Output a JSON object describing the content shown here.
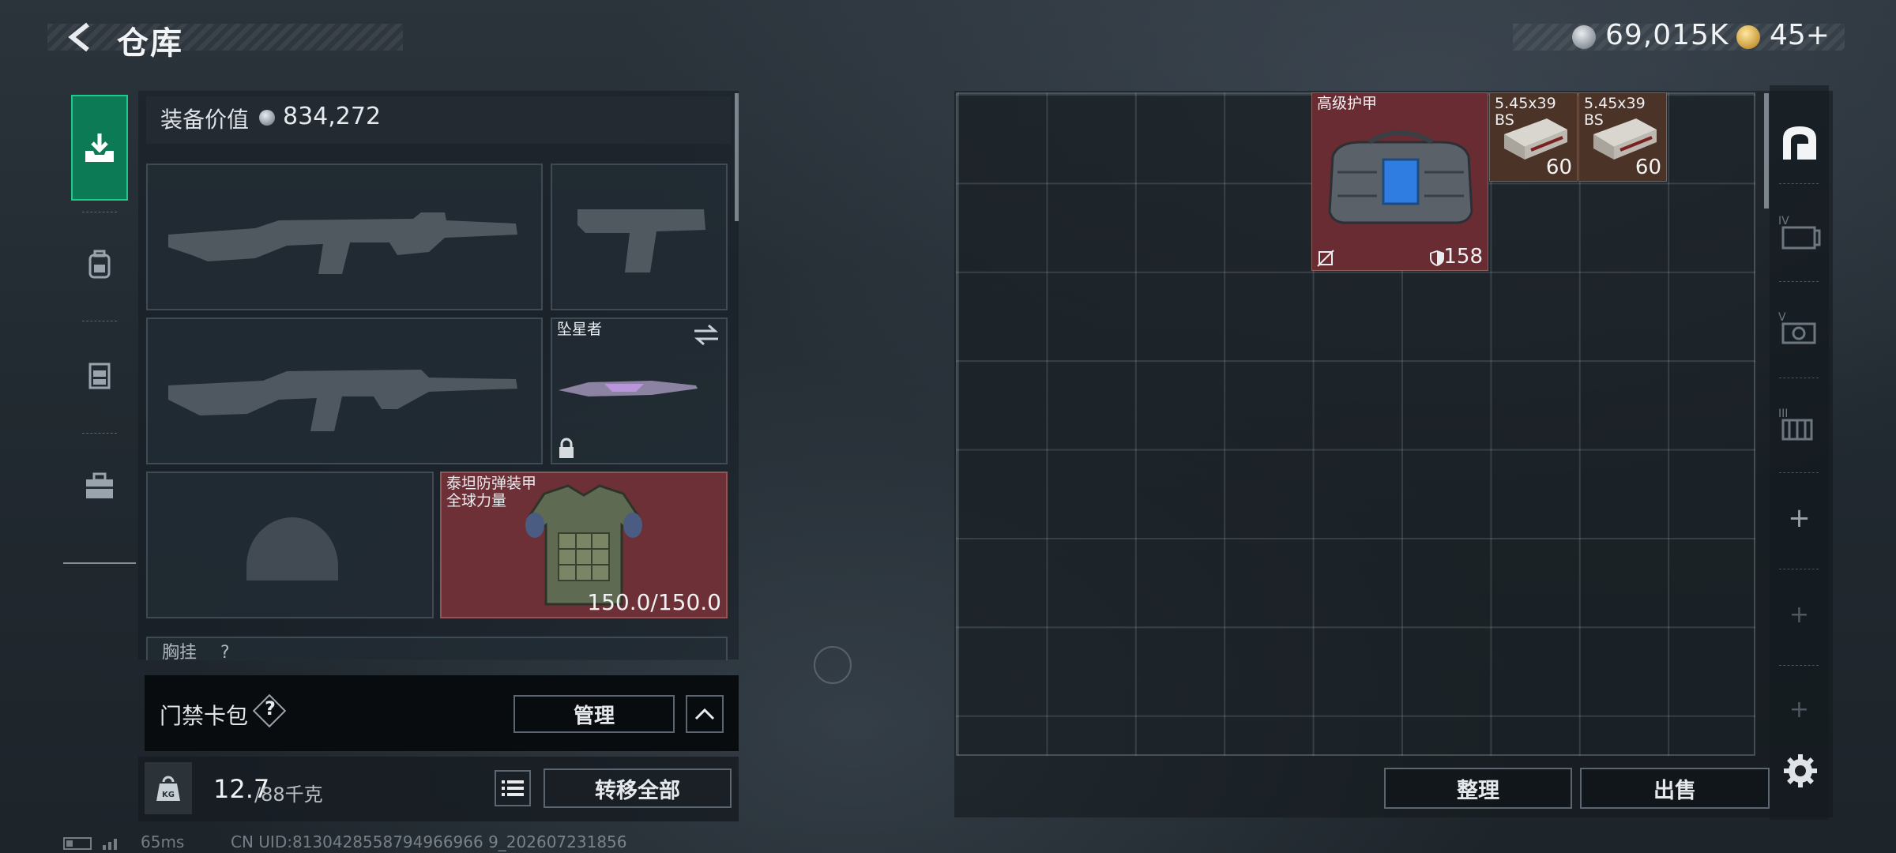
{
  "header": {
    "title": "仓库",
    "coins": "69,015K",
    "tickets": "45+"
  },
  "left_nav": {
    "items": [
      {
        "icon": "deposit-icon",
        "active": true
      },
      {
        "icon": "backpack-icon",
        "active": false
      },
      {
        "icon": "rig-icon",
        "active": false
      },
      {
        "icon": "case-icon",
        "active": false
      }
    ]
  },
  "equipment": {
    "value_label": "装备价值",
    "value": "834,272",
    "melee_name": "坠星者",
    "armor_name": "泰坦防弹装甲",
    "armor_sub": "全球力量",
    "armor_durability": "150.0/150.0",
    "chest_rig_label": "胸挂",
    "chest_rig_help": "?"
  },
  "keycard": {
    "label": "门禁卡包",
    "help": "?",
    "manage_label": "管理"
  },
  "capacity": {
    "current": "12.7",
    "max": "/88千克",
    "transfer_all_label": "转移全部",
    "icon_text": "KG"
  },
  "status": {
    "ping": "65ms",
    "uid": "CN UID:8130428558794966966 9_202607231856"
  },
  "stash": {
    "items": [
      {
        "name": "高级护甲",
        "armor_value": "158"
      },
      {
        "name": "5.45x39",
        "name2": "BS",
        "count": "60"
      },
      {
        "name": "5.45x39",
        "name2": "BS",
        "count": "60"
      }
    ],
    "sort_label": "整理",
    "sell_label": "出售"
  },
  "right_tabs": {
    "labels": [
      "IV",
      "V",
      "III"
    ],
    "add": "+"
  },
  "colors": {
    "active_tab": "#0d7a56",
    "red_slot": "#6e3037",
    "ammo_slot": "#4b3328"
  }
}
